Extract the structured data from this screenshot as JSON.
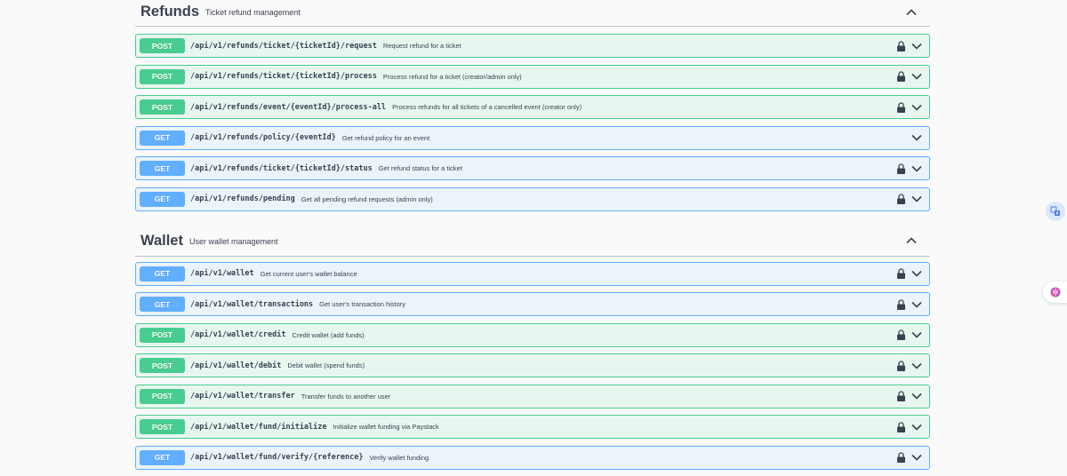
{
  "sections": [
    {
      "name": "Refunds",
      "description": "Ticket refund management",
      "operations": [
        {
          "method": "POST",
          "path": "/api/v1/refunds/ticket/{ticketId}/request",
          "summary": "Request refund for a ticket",
          "locked": true
        },
        {
          "method": "POST",
          "path": "/api/v1/refunds/ticket/{ticketId}/process",
          "summary": "Process refund for a ticket (creator/admin only)",
          "locked": true
        },
        {
          "method": "POST",
          "path": "/api/v1/refunds/event/{eventId}/process-all",
          "summary": "Process refunds for all tickets of a cancelled event (creator only)",
          "locked": true
        },
        {
          "method": "GET",
          "path": "/api/v1/refunds/policy/{eventId}",
          "summary": "Get refund policy for an event",
          "locked": false
        },
        {
          "method": "GET",
          "path": "/api/v1/refunds/ticket/{ticketId}/status",
          "summary": "Get refund status for a ticket",
          "locked": true
        },
        {
          "method": "GET",
          "path": "/api/v1/refunds/pending",
          "summary": "Get all pending refund requests (admin only)",
          "locked": true
        }
      ]
    },
    {
      "name": "Wallet",
      "description": "User wallet management",
      "operations": [
        {
          "method": "GET",
          "path": "/api/v1/wallet",
          "summary": "Get current user's wallet balance",
          "locked": true
        },
        {
          "method": "GET",
          "path": "/api/v1/wallet/transactions",
          "summary": "Get user's transaction history",
          "locked": true
        },
        {
          "method": "POST",
          "path": "/api/v1/wallet/credit",
          "summary": "Credit wallet (add funds)",
          "locked": true
        },
        {
          "method": "POST",
          "path": "/api/v1/wallet/debit",
          "summary": "Debit wallet (spend funds)",
          "locked": true
        },
        {
          "method": "POST",
          "path": "/api/v1/wallet/transfer",
          "summary": "Transfer funds to another user",
          "locked": true
        },
        {
          "method": "POST",
          "path": "/api/v1/wallet/fund/initialize",
          "summary": "Initialize wallet funding via Paystack",
          "locked": true
        },
        {
          "method": "GET",
          "path": "/api/v1/wallet/fund/verify/{reference}",
          "summary": "Verify wallet funding",
          "locked": true
        }
      ]
    }
  ],
  "icons": {
    "lock": "lock-icon",
    "expand": "chevron-down-icon",
    "collapse": "chevron-up-icon",
    "translate": "translate-icon",
    "assistant": "ai-assistant-icon"
  },
  "colors": {
    "post": "#49cc90",
    "get": "#61affe",
    "text": "#3b4151"
  }
}
